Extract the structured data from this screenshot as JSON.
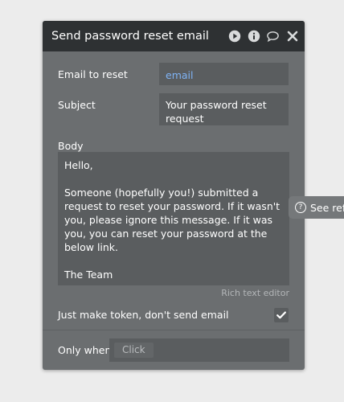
{
  "panel": {
    "title": "Send password reset email",
    "email_label": "Email to reset",
    "email_value": "email",
    "subject_label": "Subject",
    "subject_value": "Your password reset request",
    "body_label": "Body",
    "body_value": "Hello,\n\nSomeone (hopefully you!) submitted a request to reset your password. If it wasn't you, please ignore this message. If it was you, you can reset your password at the below link.\n\nThe Team",
    "rich_text_label": "Rich text editor",
    "token_label": "Just make token, don't send email",
    "token_checked": true,
    "only_when_label": "Only when",
    "click_label": "Click"
  },
  "side_tab": {
    "label": "See refe",
    "icon_glyph": "?"
  },
  "icons": [
    "play-icon",
    "info-icon",
    "comment-icon",
    "close-icon",
    "check-icon",
    "help-icon"
  ],
  "colors": {
    "background": "#ececec",
    "panel": "#6b6e70",
    "header": "#2e3133",
    "field": "#5a5d5f",
    "link": "#7fb3f5"
  }
}
